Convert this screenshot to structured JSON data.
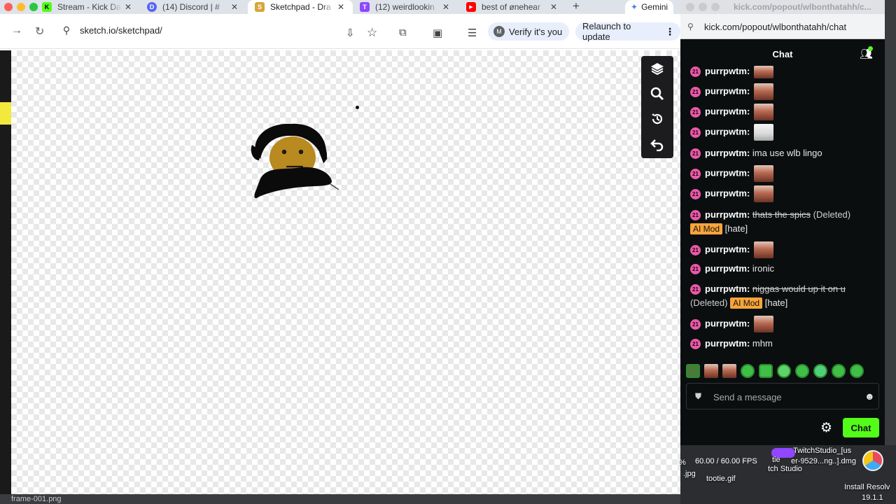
{
  "browser": {
    "tabs": [
      {
        "title": "Stream - Kick Da",
        "fav": "K",
        "fav_color": "#53fc18"
      },
      {
        "title": "(14) Discord | #",
        "fav": "D",
        "fav_color": "#5865f2"
      },
      {
        "title": "Sketchpad - Dra",
        "fav": "S",
        "fav_color": "#d6a63a"
      },
      {
        "title": "(12) weirdlookin",
        "fav": "T",
        "fav_color": "#9146ff"
      },
      {
        "title": "best of ønehear",
        "fav": "▶",
        "fav_color": "#ff0000"
      }
    ],
    "new_tab": "+",
    "gemini_label": "Gemini",
    "url": "sketch.io/sketchpad/",
    "verify_label": "Verify it's you",
    "verify_avatar": "M",
    "relaunch_label": "Relaunch to update"
  },
  "sketchpad": {
    "tools": [
      "layers-icon",
      "zoom-icon",
      "history-icon",
      "undo-icon"
    ]
  },
  "kick": {
    "window_title": "kick.com/popout/wlbonthatahh/c...",
    "url": "kick.com/popout/wlbonthatahh/chat",
    "chat_title": "Chat",
    "messages": [
      {
        "badge": "21",
        "user": "purrpwtm:",
        "text": "",
        "emote": "face"
      },
      {
        "badge": "21",
        "user": "purrpwtm:",
        "text": "",
        "emote": "face"
      },
      {
        "badge": "21",
        "user": "purrpwtm:",
        "text": "",
        "emote": "face"
      },
      {
        "badge": "21",
        "user": "purrpwtm:",
        "text": "",
        "emote": "light"
      },
      {
        "badge": "21",
        "user": "purrpwtm:",
        "text": "ima use wlb lingo",
        "emote": ""
      },
      {
        "badge": "21",
        "user": "purrpwtm:",
        "text": "",
        "emote": "face"
      },
      {
        "badge": "21",
        "user": "purrpwtm:",
        "text": "",
        "emote": "face"
      },
      {
        "badge": "21",
        "user": "purrpwtm:",
        "deleted_text": "thats the spics",
        "deleted_label": "(Deleted)",
        "mod_label": "AI Mod",
        "reason": "[hate]"
      },
      {
        "badge": "21",
        "user": "purrpwtm:",
        "text": "",
        "emote": "face"
      },
      {
        "badge": "21",
        "user": "purrpwtm:",
        "text": "ironic",
        "emote": ""
      },
      {
        "badge": "21",
        "user": "purrpwtm:",
        "deleted_text": "niggas would up it on u",
        "deleted_label": "(Deleted)",
        "mod_label": "AI Mod",
        "reason": "[hate]"
      },
      {
        "badge": "21",
        "user": "purrpwtm:",
        "text": "",
        "emote": "face"
      },
      {
        "badge": "21",
        "user": "purrpwtm:",
        "text": "mhm",
        "emote": ""
      }
    ],
    "input_placeholder": "Send a message",
    "chat_button": "Chat"
  },
  "desktop": {
    "fps": "60.00 / 60.00 FPS",
    "fps_prefix": "%",
    "twitch_file": "TwitchStudio_[us",
    "twitch_file2": "er-9529...ng..].dmg",
    "tie_label": "tie",
    "twitch_studio": "tch Studio",
    "tootie": "tootie.gif",
    "jpg": ".jpg",
    "install": "Install Resolv",
    "install_ver": "19.1.1",
    "frame_file": "frame-001.png"
  }
}
